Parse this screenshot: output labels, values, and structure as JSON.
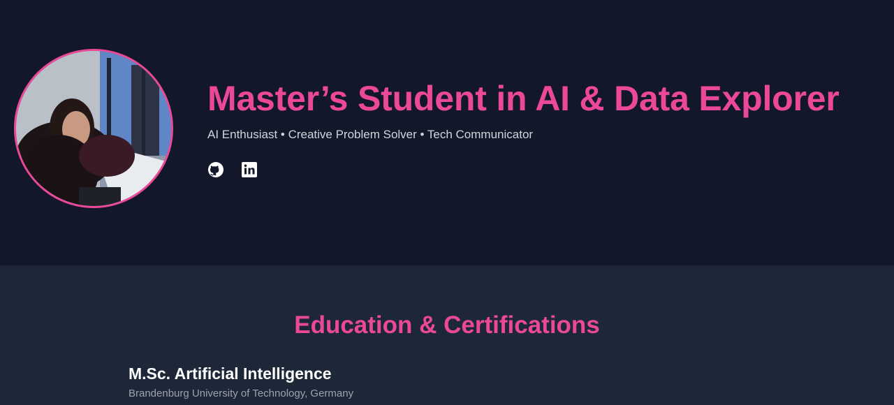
{
  "hero": {
    "headline": "Master’s Student in AI & Data Explorer",
    "tagline": "AI Enthusiast • Creative Problem Solver • Tech Communicator",
    "avatar_icon": "profile-photo",
    "socials": [
      {
        "name": "GitHub",
        "icon": "github-icon"
      },
      {
        "name": "LinkedIn",
        "icon": "linkedin-icon"
      }
    ]
  },
  "education": {
    "title": "Education & Certifications",
    "items": [
      {
        "degree": "M.Sc. Artificial Intelligence",
        "school": "Brandenburg University of Technology, Germany"
      }
    ]
  },
  "colors": {
    "accent": "#ec4899",
    "hero_bg": "#121829",
    "section_bg": "#1e2738"
  }
}
